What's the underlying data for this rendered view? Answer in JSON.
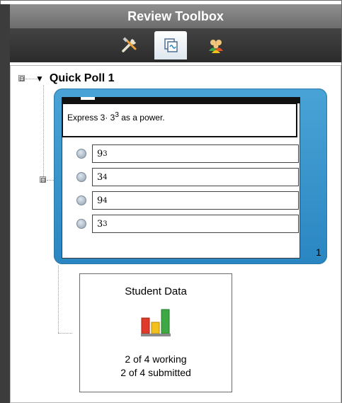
{
  "window": {
    "title": "Review Toolbox"
  },
  "tabs": [
    {
      "icon": "tools-icon",
      "selected": false
    },
    {
      "icon": "review-pages-icon",
      "selected": true
    },
    {
      "icon": "class-icon",
      "selected": false
    }
  ],
  "tree": {
    "poll_title": "Quick Poll 1",
    "expand_symbol": "⊟"
  },
  "poll": {
    "question_prefix": "Express 3· 3",
    "question_exp": "3",
    "question_suffix": " as a power.",
    "answers": [
      {
        "base": "9",
        "exp": "3"
      },
      {
        "base": "3",
        "exp": "4"
      },
      {
        "base": "9",
        "exp": "4"
      },
      {
        "base": "3",
        "exp": "3"
      }
    ],
    "page_count": "1"
  },
  "student_data": {
    "title": "Student Data",
    "working": "2 of 4 working",
    "submitted": "2 of 4 submitted"
  },
  "colors": {
    "accent": "#2a86c2",
    "bar_red": "#e03b2a",
    "bar_yellow": "#f2c21b",
    "bar_green": "#3da844"
  }
}
